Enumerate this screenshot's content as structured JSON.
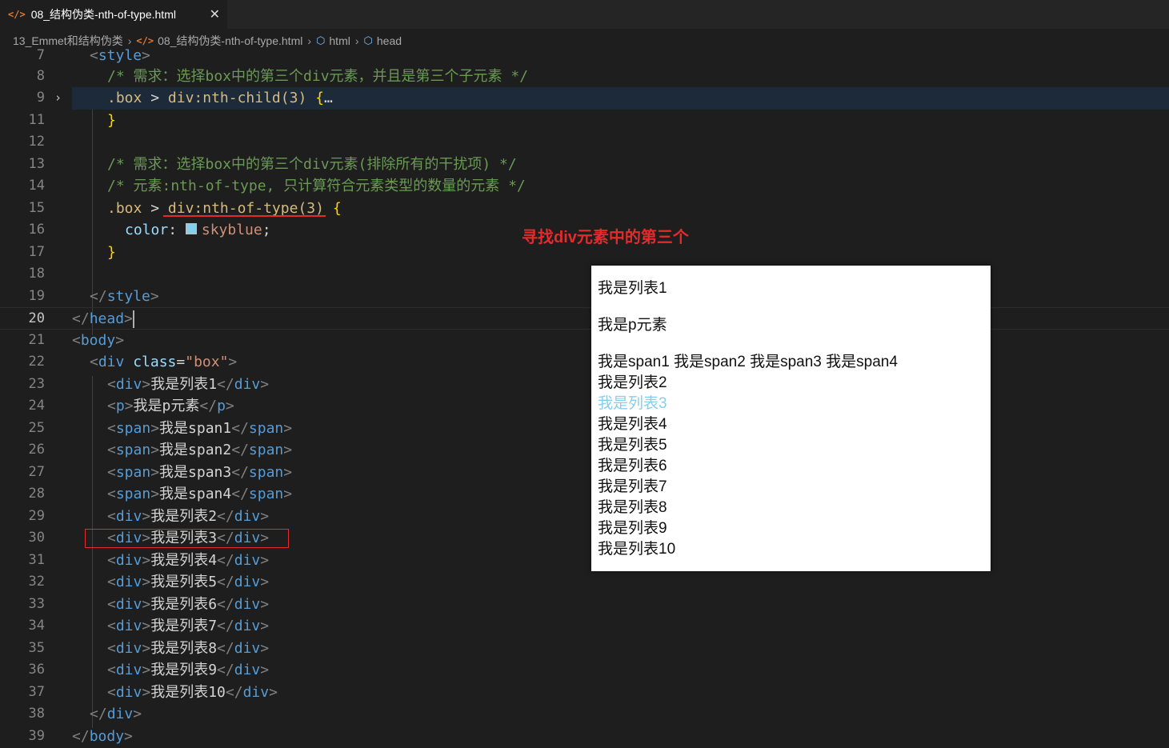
{
  "tab": {
    "icon": "</>",
    "title": "08_结构伪类-nth-of-type.html",
    "close": "✕"
  },
  "breadcrumb": {
    "folder": "13_Emmet和结构伪类",
    "file": "08_结构伪类-nth-of-type.html",
    "item1": "html",
    "item2": "head"
  },
  "editor": {
    "line_numbers": [
      "7",
      "8",
      "9",
      "11",
      "12",
      "13",
      "14",
      "15",
      "16",
      "17",
      "18",
      "19",
      "20",
      "21",
      "22",
      "23",
      "24",
      "25",
      "26",
      "27",
      "28",
      "29",
      "30",
      "31",
      "32",
      "33",
      "34",
      "35",
      "36",
      "37",
      "38",
      "39"
    ],
    "comment1": "/* 需求：选择box中的第三个div元素，并且是第三个子元素 */",
    "comment2": "/* 需求：选择box中的第三个div元素(排除所有的干扰项) */",
    "comment3": "/* 元素:nth-of-type, 只计算符合元素类型的数量的元素 */",
    "sel_box": ".box",
    "gt": ">",
    "sel_nth_child": "div:nth-child(3)",
    "open_brace": "{",
    "close_brace": "}",
    "ellipsis": "…",
    "sel_nth_type": "div:nth-of-type(3)",
    "prop": "color",
    "colon": ":",
    "value": "skyblue",
    "semicolon": ";",
    "tag_style": "style",
    "tag_head": "head",
    "tag_body": "body",
    "tag_div": "div",
    "tag_p": "p",
    "tag_span": "span",
    "attr_class": "class",
    "eq": "=",
    "attr_value": "\"box\"",
    "lt": "<",
    "lt_slash": "</",
    "text_list1": "我是列表1",
    "text_p": "我是p元素",
    "text_span1": "我是span1",
    "text_span2": "我是span2",
    "text_span3": "我是span3",
    "text_span4": "我是span4",
    "text_list2": "我是列表2",
    "text_list3": "我是列表3",
    "text_list4": "我是列表4",
    "text_list5": "我是列表5",
    "text_list6": "我是列表6",
    "text_list7": "我是列表7",
    "text_list8": "我是列表8",
    "text_list9": "我是列表9",
    "text_list10": "我是列表10"
  },
  "annotation": "寻找div元素中的第三个",
  "preview": {
    "items": [
      "我是列表1",
      "我是p元素",
      "我是span1 我是span2 我是span3 我是span4",
      "我是列表2",
      "我是列表3",
      "我是列表4",
      "我是列表5",
      "我是列表6",
      "我是列表7",
      "我是列表8",
      "我是列表9",
      "我是列表10"
    ],
    "highlight_color": "#87ceeb"
  }
}
